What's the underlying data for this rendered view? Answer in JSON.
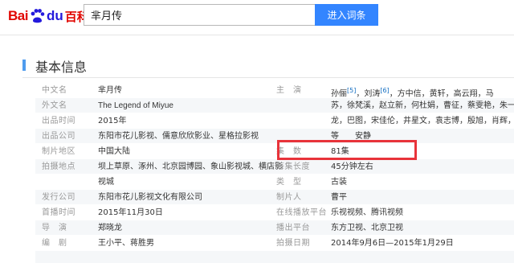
{
  "header": {
    "logo_bai": "Bai",
    "logo_du": "du",
    "logo_baike": "百科",
    "search_value": "芈月传",
    "search_button": "进入词条"
  },
  "section": {
    "title": "基本信息"
  },
  "left": [
    {
      "label": "中文名",
      "value": "芈月传"
    },
    {
      "label": "外文名",
      "value": "The Legend of Miyue"
    },
    {
      "label": "出品时间",
      "value": "2015年"
    },
    {
      "label": "出品公司",
      "value": "东阳市花儿影视、儒意欣欣影业、星格拉影视"
    },
    {
      "label": "制片地区",
      "value": "中国大陆"
    },
    {
      "label": "拍摄地点",
      "value": "坝上草原、涿州、北京园博园、象山影视城、横店影"
    },
    {
      "label": "",
      "value": "视城"
    },
    {
      "label": "发行公司",
      "value": "东阳市花儿影视文化有限公司"
    },
    {
      "label": "首播时间",
      "value": "2015年11月30日"
    },
    {
      "label": "导　演",
      "value": "郑晓龙"
    },
    {
      "label": "编　剧",
      "value": "王小平、蒋胜男"
    }
  ],
  "right": {
    "cast_label": "主　演",
    "cast_lines": [
      "孙俪",
      "苏，徐梵溪，赵立新，何杜娟，曹征，蔡雯艳，朱一",
      "龙，巴图，宋佳伦，井星文，袁志博，殷旭，肖辉，",
      "等　　安静"
    ],
    "cast_line1_rest": "，刘涛",
    "cast_line1_tail": "，方中信，黄轩，高云翔，马",
    "ref1": "[5]",
    "ref2": "[6]",
    "rows": [
      {
        "label": "集　数",
        "value": "81集"
      },
      {
        "label": "每集长度",
        "value": "45分钟左右"
      },
      {
        "label": "类　型",
        "value": "古装"
      },
      {
        "label": "制片人",
        "value": "曹平"
      },
      {
        "label": "在线播放平台",
        "value": "乐视视频、腾讯视频"
      },
      {
        "label": "播出平台",
        "value": "东方卫视、北京卫视"
      },
      {
        "label": "拍摄日期",
        "value": "2014年9月6日—2015年1月29日"
      }
    ]
  },
  "colors": {
    "accent": "#3385ff",
    "logo_red": "#e10601",
    "logo_blue": "#2319dc",
    "highlight": "#e8333a"
  }
}
